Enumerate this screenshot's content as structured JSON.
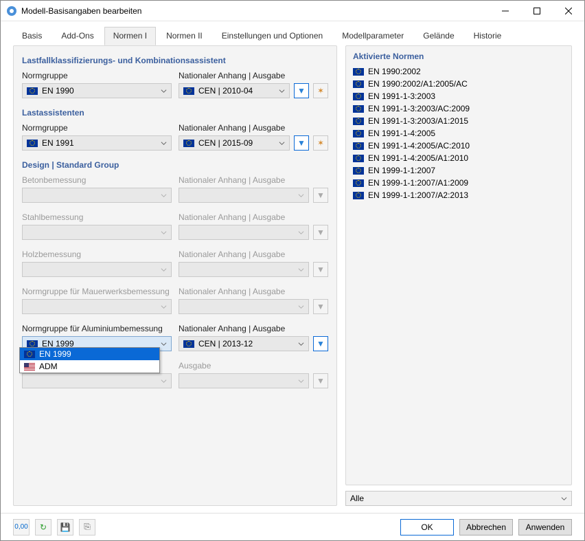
{
  "window": {
    "title": "Modell-Basisangaben bearbeiten"
  },
  "tabs": [
    "Basis",
    "Add-Ons",
    "Normen I",
    "Normen II",
    "Einstellungen und Optionen",
    "Modellparameter",
    "Gelände",
    "Historie"
  ],
  "activeTab": 2,
  "left": {
    "sec1": {
      "title": "Lastfallklassifizierungs- und Kombinationsassistent",
      "group_lbl": "Normgruppe",
      "group_val": "EN 1990",
      "annex_lbl": "Nationaler Anhang | Ausgabe",
      "annex_val": "CEN | 2010-04"
    },
    "sec2": {
      "title": "Lastassistenten",
      "group_lbl": "Normgruppe",
      "group_val": "EN 1991",
      "annex_lbl": "Nationaler Anhang | Ausgabe",
      "annex_val": "CEN | 2015-09"
    },
    "design": {
      "title": "Design | Standard Group",
      "rows": [
        {
          "lbl": "Betonbemessung",
          "annex_lbl": "Nationaler Anhang | Ausgabe"
        },
        {
          "lbl": "Stahlbemessung",
          "annex_lbl": "Nationaler Anhang | Ausgabe"
        },
        {
          "lbl": "Holzbemessung",
          "annex_lbl": "Nationaler Anhang | Ausgabe"
        },
        {
          "lbl": "Normgruppe für Mauerwerksbemessung",
          "annex_lbl": "Nationaler Anhang | Ausgabe"
        }
      ],
      "alu": {
        "lbl": "Normgruppe für Aluminiumbemessung",
        "val": "EN 1999",
        "annex_lbl": "Nationaler Anhang | Ausgabe",
        "annex_val": "CEN | 2013-12",
        "options": [
          "EN 1999",
          "ADM"
        ]
      },
      "extra": {
        "annex_lbl": "Ausgabe"
      }
    }
  },
  "right": {
    "title": "Aktivierte Normen",
    "items": [
      "EN 1990:2002",
      "EN 1990:2002/A1:2005/AC",
      "EN 1991-1-3:2003",
      "EN 1991-1-3:2003/AC:2009",
      "EN 1991-1-3:2003/A1:2015",
      "EN 1991-1-4:2005",
      "EN 1991-1-4:2005/AC:2010",
      "EN 1991-1-4:2005/A1:2010",
      "EN 1999-1-1:2007",
      "EN 1999-1-1:2007/A1:2009",
      "EN 1999-1-1:2007/A2:2013"
    ],
    "filter_val": "Alle"
  },
  "buttons": {
    "ok": "OK",
    "cancel": "Abbrechen",
    "apply": "Anwenden"
  }
}
